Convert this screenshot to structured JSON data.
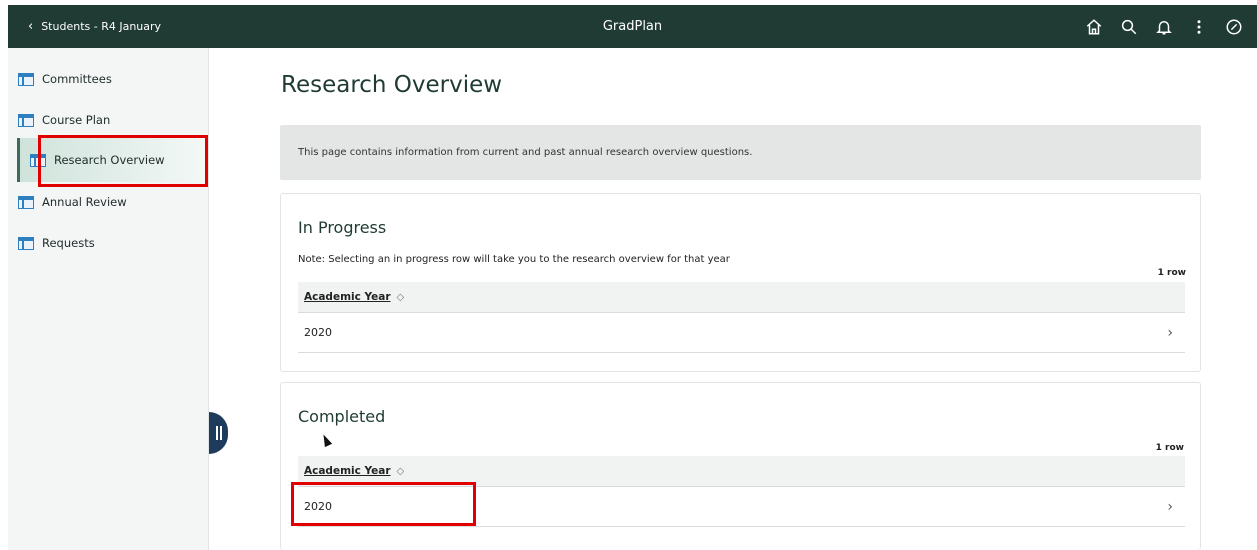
{
  "header": {
    "back_label": "Students - R4 January",
    "app_title": "GradPlan",
    "icons": [
      "home-icon",
      "search-icon",
      "bell-icon",
      "more-icon",
      "compass-icon"
    ]
  },
  "sidebar": {
    "items": [
      {
        "label": "Committees"
      },
      {
        "label": "Course Plan"
      },
      {
        "label": "Research Overview"
      },
      {
        "label": "Annual Review"
      },
      {
        "label": "Requests"
      }
    ]
  },
  "main": {
    "title": "Research Overview",
    "info": "This page contains information from current and past annual research overview questions.",
    "in_progress": {
      "heading": "In Progress",
      "note": "Note: Selecting an in progress row will take you to the research overview for that year",
      "row_count": "1 row",
      "column": "Academic Year",
      "rows": [
        "2020"
      ]
    },
    "completed": {
      "heading": "Completed",
      "row_count": "1 row",
      "column": "Academic Year",
      "rows": [
        "2020"
      ]
    }
  },
  "colors": {
    "header_bg": "#1f3b34",
    "highlight": "#e00000",
    "accent_icon": "#2d7fc0"
  }
}
